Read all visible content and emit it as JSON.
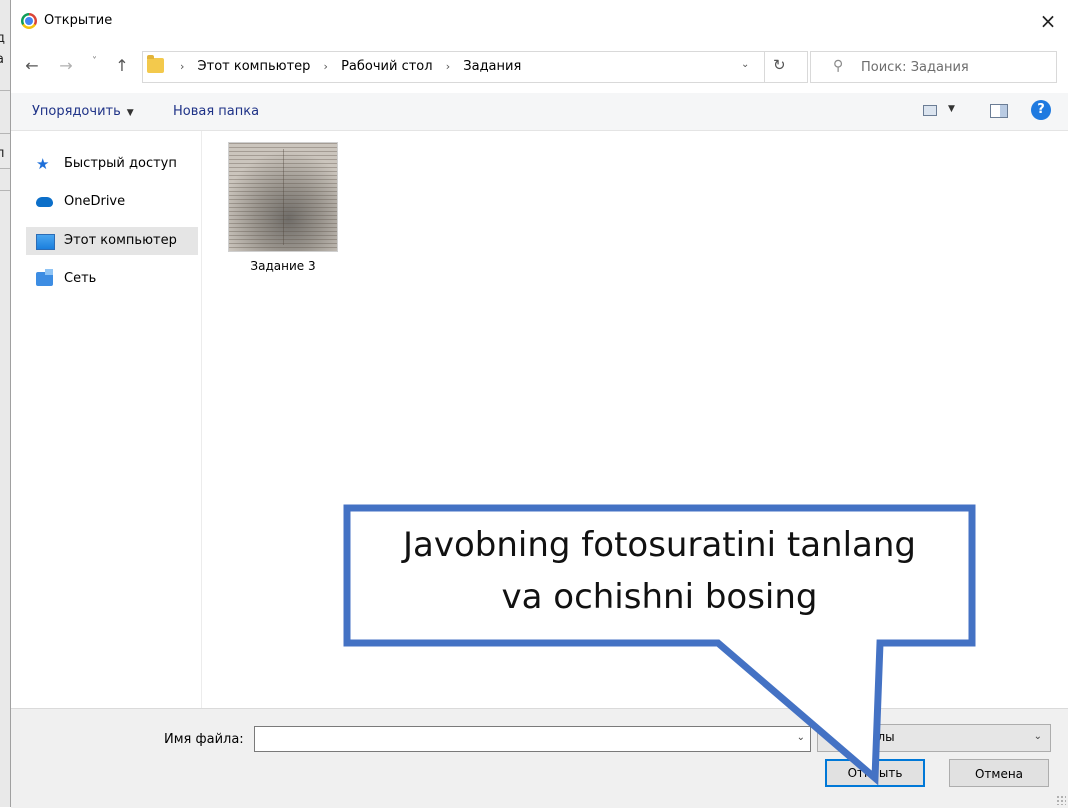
{
  "background_window": {
    "chars": [
      "д",
      "а",
      "п"
    ]
  },
  "dialog": {
    "title": "Открытие",
    "close_glyph": "×"
  },
  "navigation": {
    "back_glyph": "←",
    "forward_glyph": "→",
    "recent_glyph": "˅",
    "up_glyph": "↑"
  },
  "address": {
    "crumbs": [
      "Этот компьютер",
      "Рабочий стол",
      "Задания"
    ],
    "separator": "›",
    "dropdown_glyph": "⌄",
    "refresh_glyph": "↻"
  },
  "search": {
    "placeholder": "Поиск: Задания",
    "icon": "search-icon"
  },
  "toolbar": {
    "organize_label": "Упорядочить",
    "organize_caret": "▼",
    "new_folder_label": "Новая папка",
    "view_caret": "▼",
    "help_glyph": "?"
  },
  "nav_pane": {
    "items": [
      {
        "label": "Быстрый доступ",
        "icon": "star-icon"
      },
      {
        "label": "OneDrive",
        "icon": "cloud-icon"
      },
      {
        "label": "Этот компьютер",
        "icon": "computer-icon",
        "selected": true
      },
      {
        "label": "Сеть",
        "icon": "network-icon"
      }
    ]
  },
  "files": [
    {
      "name": "Задание 3",
      "icon": "image-thumbnail"
    }
  ],
  "bottom": {
    "filename_label": "Имя файла:",
    "filename_value": "",
    "filetype_value": "Все файлы",
    "open_label": "Открыть",
    "cancel_label": "Отмена"
  },
  "callout": {
    "line1": "Javobning fotosuratini tanlang",
    "line2": "va ochishni bosing",
    "border_color": "#4472c4",
    "fill_color": "#ffffff"
  }
}
